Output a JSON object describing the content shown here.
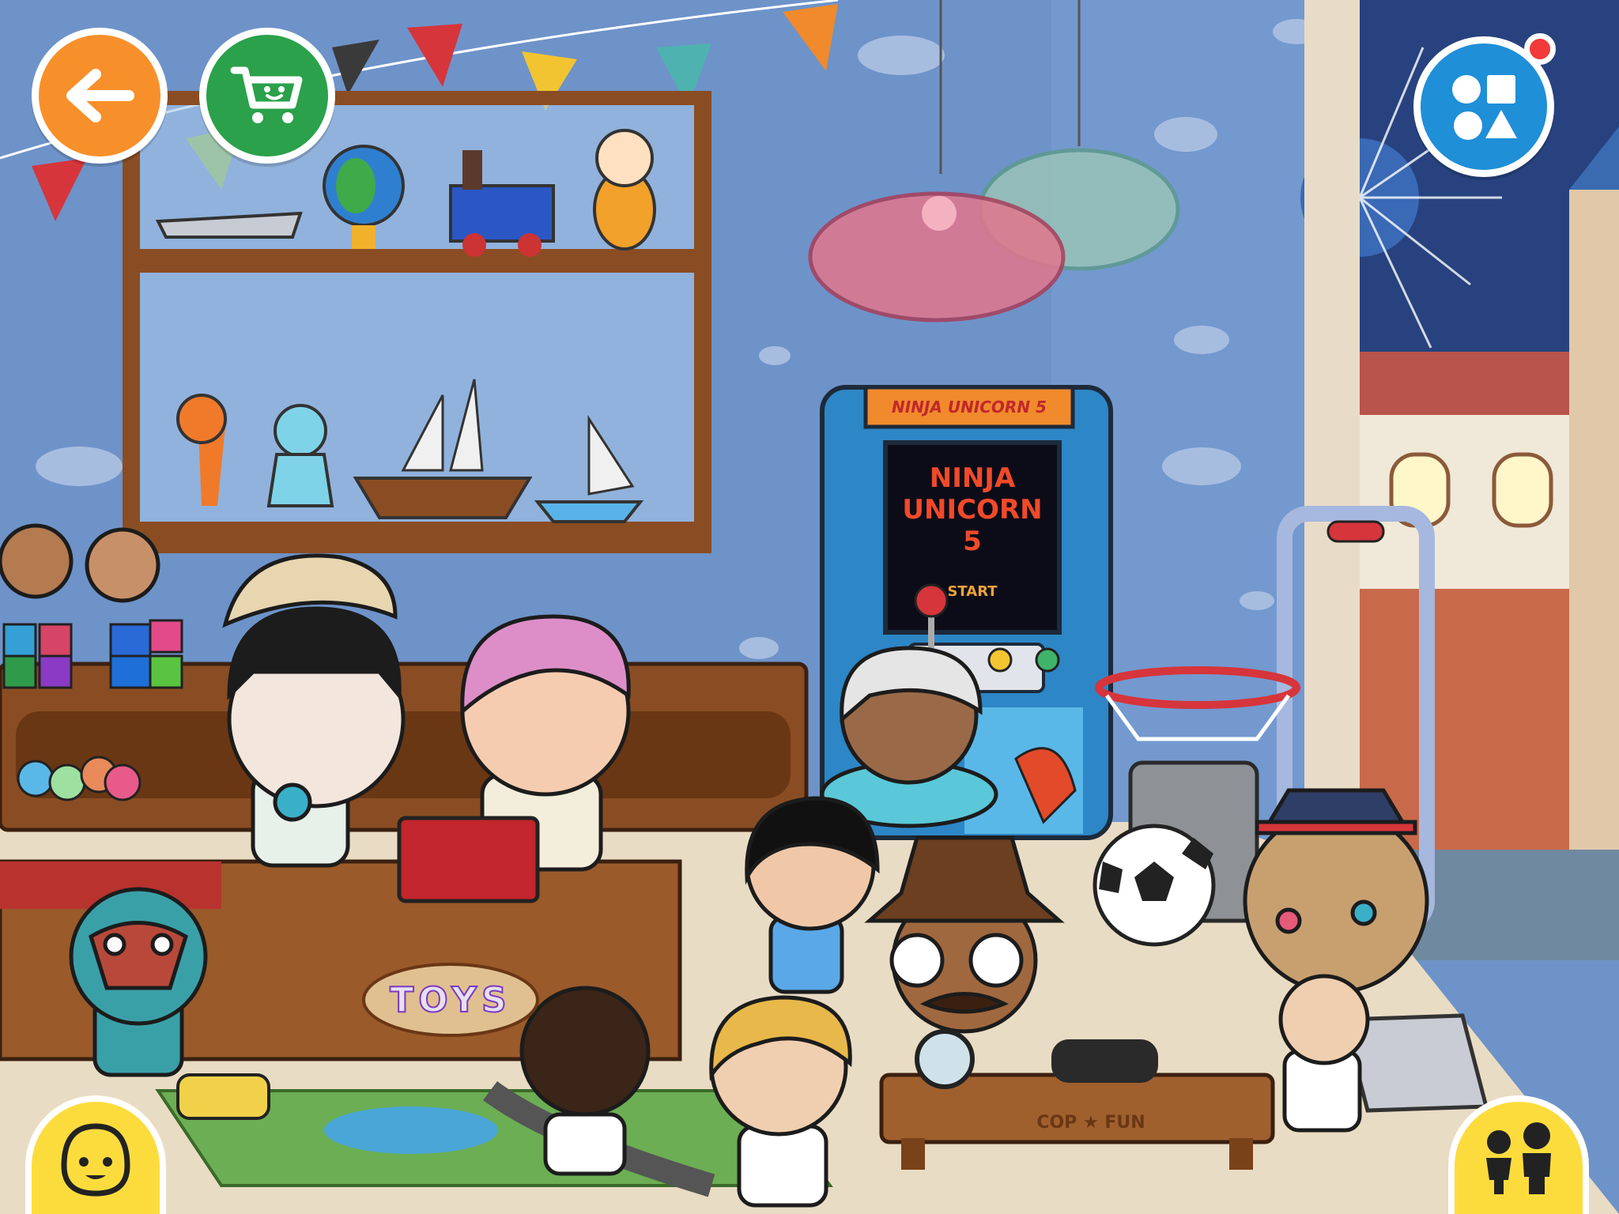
{
  "scene": {
    "arcade": {
      "marquee": "NINJA UNICORN 5",
      "screen_line1": "NINJA",
      "screen_line2": "UNICORN",
      "screen_line3": "5",
      "screen_start": "START"
    },
    "toy_box_label": "TOYS",
    "bench_label": "COP ★ FUN"
  },
  "buttons": {
    "back": {
      "icon": "arrow-left-icon",
      "color": "#f7902a"
    },
    "shop": {
      "icon": "cart-icon",
      "color": "#2aa14a"
    },
    "shapes_menu": {
      "icon": "shapes-icon",
      "color": "#1f8fd8",
      "badge_color": "#f23a3a"
    },
    "character_creator": {
      "icon": "face-icon",
      "color": "#fcdc3d"
    },
    "character_list": {
      "icon": "people-icon",
      "color": "#fcdc3d"
    }
  },
  "colors": {
    "wall": "#6e93c9",
    "floor": "#e9dcc4",
    "wood": "#8a4d23",
    "arcade": "#2d86c6"
  }
}
